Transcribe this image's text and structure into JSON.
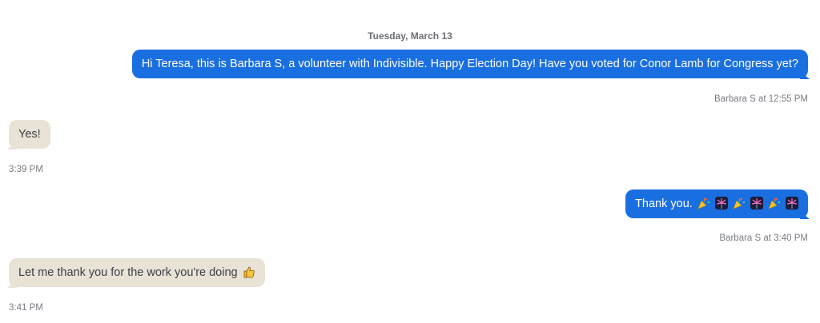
{
  "thread": {
    "date_separator": "Tuesday, March 13",
    "messages": [
      {
        "direction": "outgoing",
        "text": "Hi Teresa, this is Barbara S, a volunteer with Indivisible. Happy Election Day! Have you voted for Conor Lamb for Congress yet?",
        "meta": "Barbara S at 12:55 PM"
      },
      {
        "direction": "incoming",
        "text": "Yes!",
        "meta": "3:39 PM"
      },
      {
        "direction": "outgoing",
        "text": "Thank you.",
        "emojis": [
          "party-popper",
          "fireworks",
          "party-popper",
          "fireworks",
          "party-popper",
          "fireworks"
        ],
        "meta": "Barbara S at 3:40 PM"
      },
      {
        "direction": "incoming",
        "text": "Let me thank you for the work you're doing",
        "emojis": [
          "thumbs-up"
        ],
        "meta": "3:41 PM"
      }
    ]
  },
  "colors": {
    "outgoing_bubble": "#1a6fe0",
    "incoming_bubble": "#e8e3d6",
    "meta_text": "#7a7d83"
  }
}
